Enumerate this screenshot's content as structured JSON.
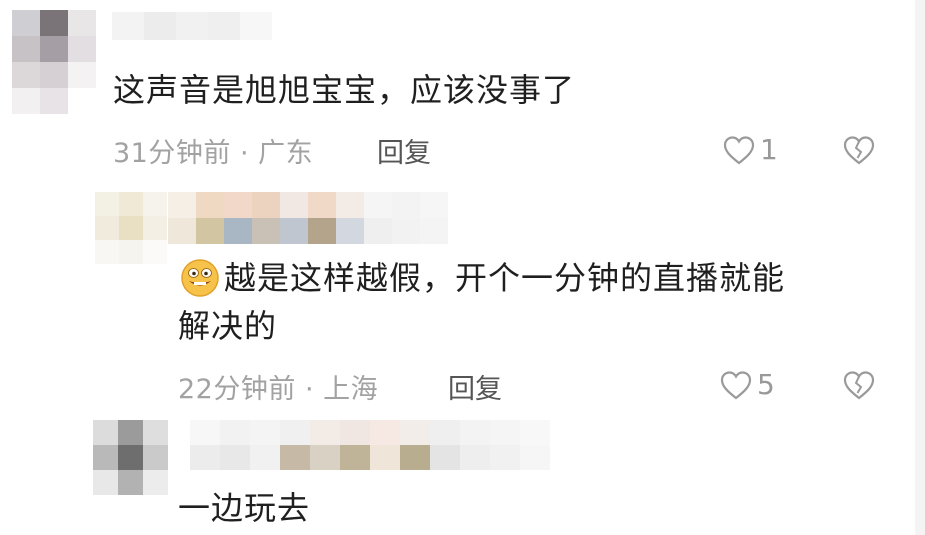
{
  "comments": [
    {
      "text": "这声音是旭旭宝宝，应该没事了",
      "time": "31分钟前",
      "location": "广东",
      "reply_label": "回复",
      "like_count": "1"
    },
    {
      "text_line1": "越是这样越假，开个一分钟的直播就能",
      "text_line2": "解决的",
      "time": "22分钟前",
      "location": "上海",
      "reply_label": "回复",
      "like_count": "5"
    },
    {
      "text": "一边玩去"
    }
  ],
  "separator": "·",
  "icons": {
    "like": "heart-outline-icon",
    "dislike": "broken-heart-icon",
    "emoji": "grinning-emoji-icon"
  }
}
